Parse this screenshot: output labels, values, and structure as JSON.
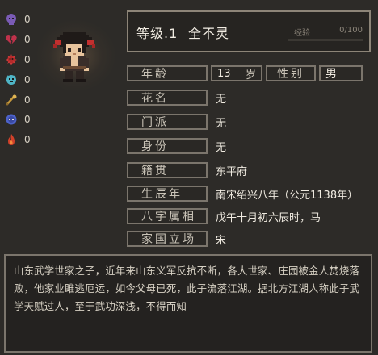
{
  "stats": [
    {
      "icon": "purple-skull-icon",
      "color": "#7a5bb5",
      "value": "0"
    },
    {
      "icon": "broken-heart-icon",
      "color": "#c0324b",
      "value": "0"
    },
    {
      "icon": "red-spiky-ball-icon",
      "color": "#b52a2a",
      "value": "0"
    },
    {
      "icon": "cyan-spirit-icon",
      "color": "#4fb5c6",
      "value": "0"
    },
    {
      "icon": "golden-scroll-icon",
      "color": "#c79a3d",
      "value": "0"
    },
    {
      "icon": "blue-face-icon",
      "color": "#4d62c9",
      "value": "0"
    },
    {
      "icon": "flame-icon",
      "color": "#d2412a",
      "value": "0"
    }
  ],
  "header": {
    "level": "等级.1",
    "name": "全不灵",
    "xp_label": "经验",
    "xp_value": "0/100",
    "xp_progress": 0
  },
  "age": {
    "label": "年龄",
    "value": "13",
    "unit": "岁"
  },
  "sex": {
    "label": "性别",
    "value": "男"
  },
  "rows": [
    {
      "label": "花名",
      "value": "无"
    },
    {
      "label": "门派",
      "value": "无"
    },
    {
      "label": "身份",
      "value": "无"
    },
    {
      "label": "籍贯",
      "value": "东平府"
    },
    {
      "label": "生辰年",
      "value": "南宋绍兴八年（公元1138年）"
    },
    {
      "label": "八字属相",
      "value": "戊午十月初六辰时，马"
    },
    {
      "label": "家国立场",
      "value": "宋"
    }
  ],
  "description": "山东武学世家之子，近年来山东义军反抗不断，各大世家、庄园被金人焚烧落败，他家业雎逃厄运，如今父母已死，此子流落江湖。据北方江湖人称此子武学天赋过人，至于武功深浅，不得而知"
}
